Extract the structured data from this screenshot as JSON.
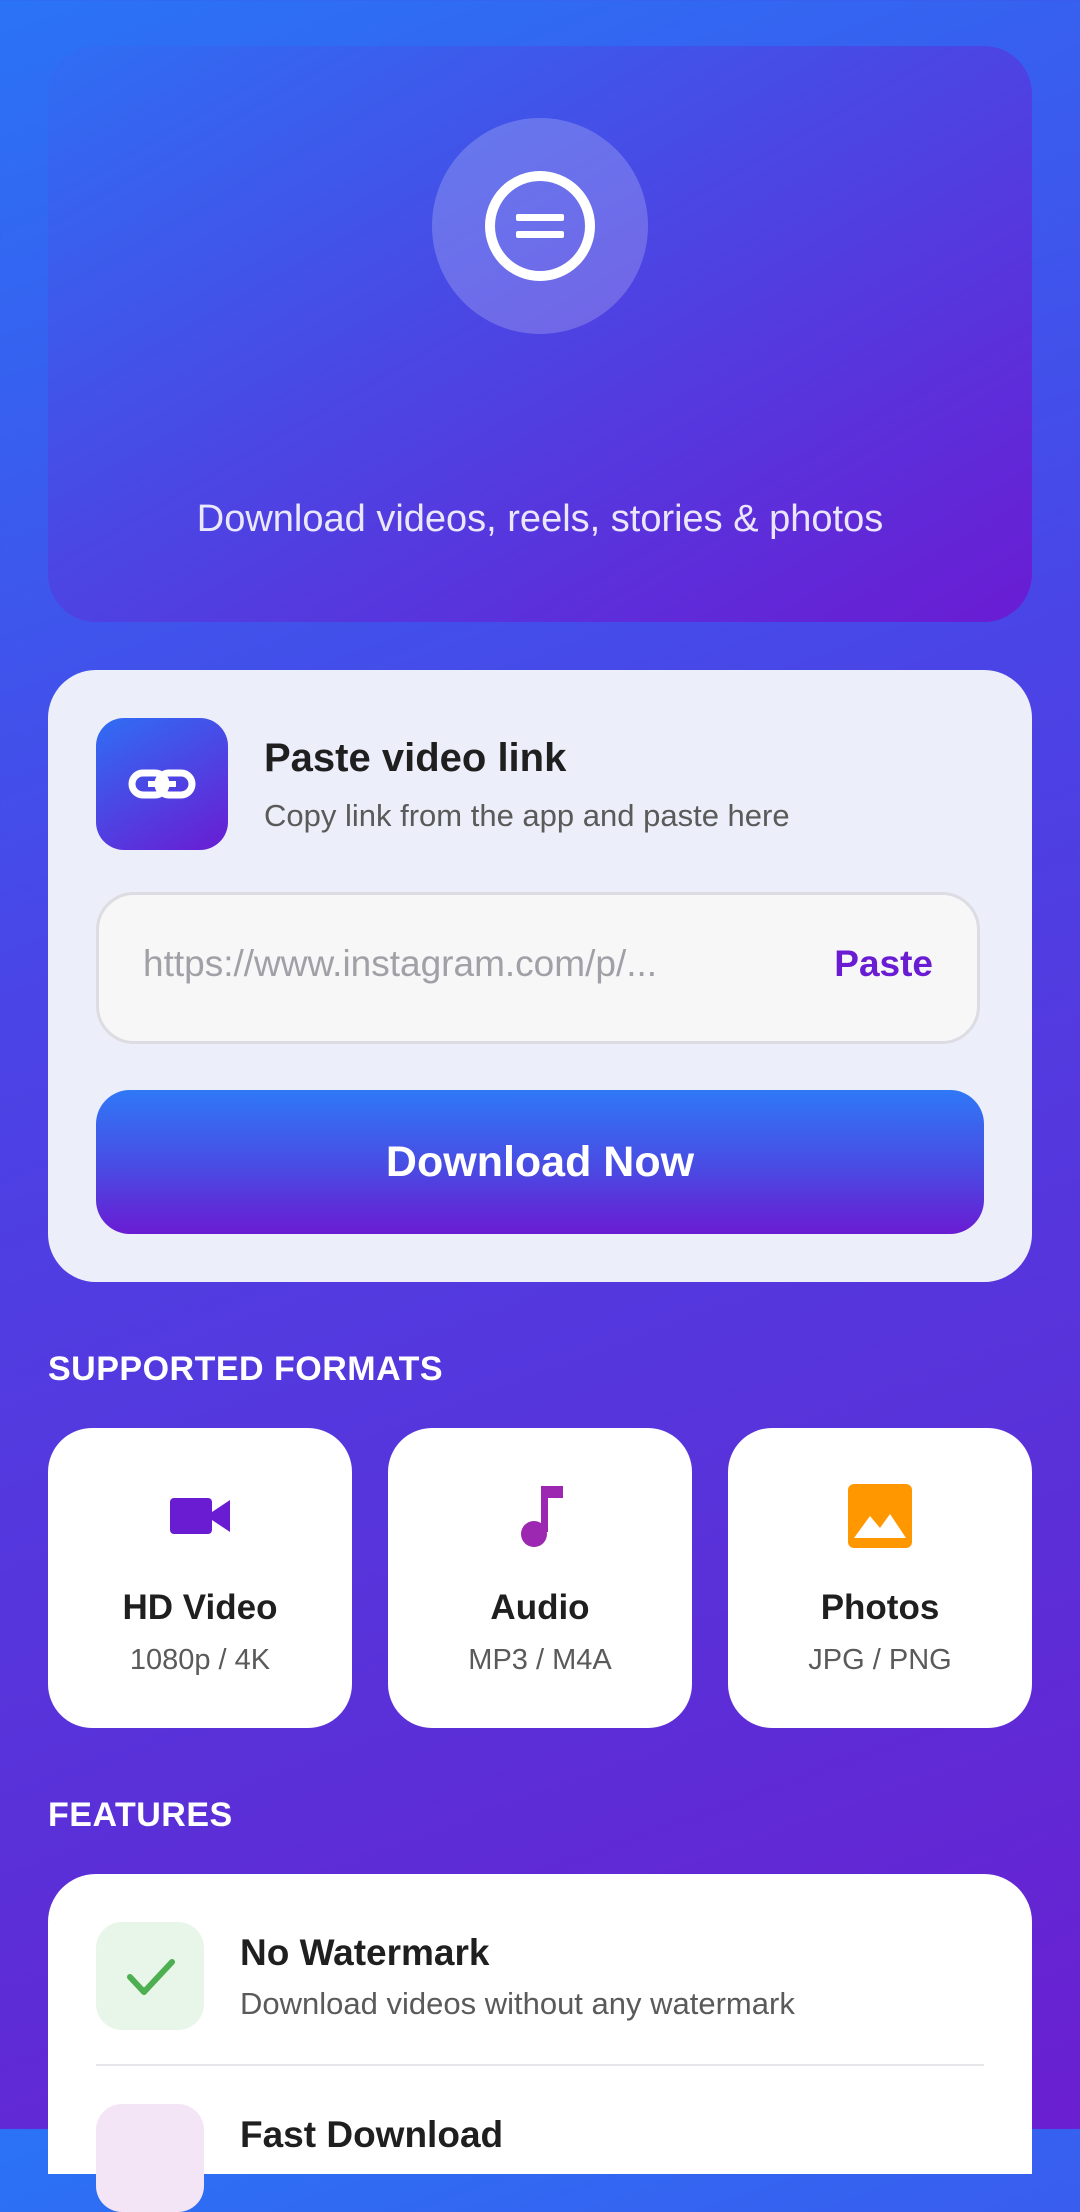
{
  "hero": {
    "subtitle": "Download videos, reels, stories & photos",
    "logo_icon": "app-logo-icon"
  },
  "download_card": {
    "title": "Paste video link",
    "subtitle": "Copy link from the app and paste here",
    "link_icon": "link-icon",
    "url_placeholder": "https://www.instagram.com/p/...",
    "url_value": "",
    "paste_label": "Paste",
    "download_label": "Download Now"
  },
  "formats": {
    "heading": "SUPPORTED FORMATS",
    "items": [
      {
        "title": "HD Video",
        "subtitle": "1080p / 4K",
        "icon": "video-camera-icon",
        "color": "#6a1cd3"
      },
      {
        "title": "Audio",
        "subtitle": "MP3 / M4A",
        "icon": "music-note-icon",
        "color": "#9c27b0"
      },
      {
        "title": "Photos",
        "subtitle": "JPG / PNG",
        "icon": "image-icon",
        "color": "#ff9800"
      }
    ]
  },
  "features": {
    "heading": "FEATURES",
    "items": [
      {
        "title": "No Watermark",
        "subtitle": "Download videos without any watermark",
        "icon": "checkmark-icon",
        "color": "#4caf50",
        "bg": "#e8f5e9"
      },
      {
        "title": "Fast Download",
        "subtitle": "",
        "icon": "bolt-icon",
        "color": "#9c27b0",
        "bg": "#f3e5f5"
      }
    ]
  },
  "colors": {
    "accent": "#6a1cd3",
    "primary_blue": "#2f6ef4"
  }
}
